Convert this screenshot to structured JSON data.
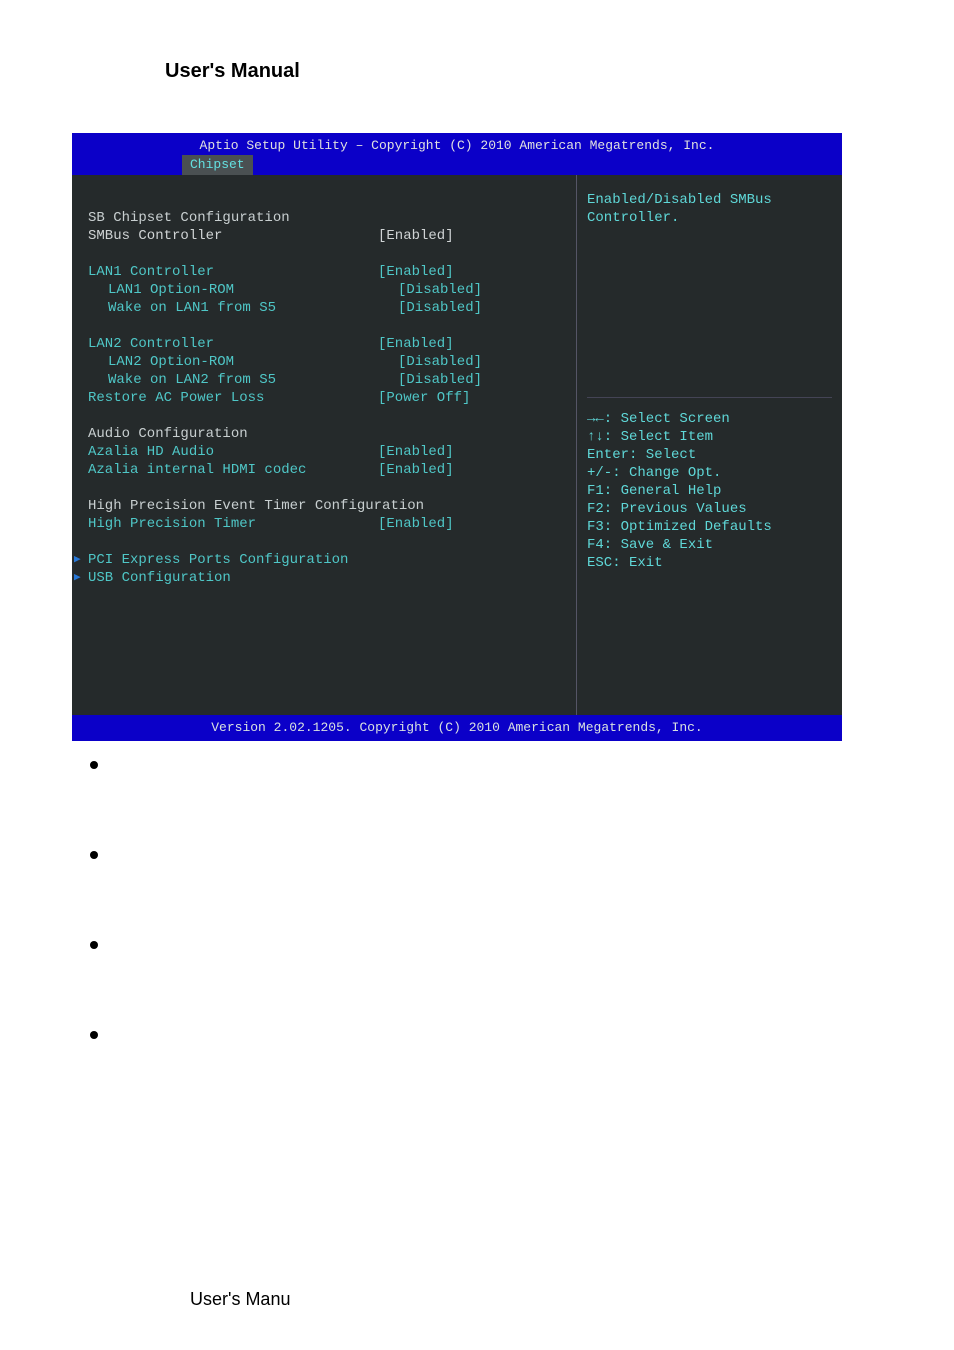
{
  "doc": {
    "header": "User's Manual",
    "footer": "User's Manu"
  },
  "bios": {
    "titlebar": "Aptio Setup Utility – Copyright (C) 2010 American Megatrends, Inc.",
    "active_tab": "Chipset",
    "footer": "Version 2.02.1205. Copyright (C) 2010 American Megatrends, Inc.",
    "left": {
      "section1": "SB Chipset Configuration",
      "smbus_lbl": "SMBus Controller",
      "smbus_val": "[Enabled]",
      "lan1_lbl": "LAN1 Controller",
      "lan1_val": "[Enabled]",
      "lan1r_lbl": "LAN1 Option-ROM",
      "lan1r_val": "[Disabled]",
      "lan1w_lbl": "Wake on LAN1 from S5",
      "lan1w_val": "[Disabled]",
      "lan2_lbl": "LAN2 Controller",
      "lan2_val": "[Enabled]",
      "lan2r_lbl": "LAN2 Option-ROM",
      "lan2r_val": "[Disabled]",
      "lan2w_lbl": "Wake on LAN2 from S5",
      "lan2w_val": "[Disabled]",
      "restore_lbl": "Restore AC Power Loss",
      "restore_val": "[Power Off]",
      "audio_hdr": "Audio Configuration",
      "azhd_lbl": "Azalia HD Audio",
      "azhd_val": "[Enabled]",
      "azhdmi_lbl": "Azalia internal HDMI codec",
      "azhdmi_val": "[Enabled]",
      "hpet_hdr": "High Precision Event Timer Configuration",
      "hpet_lbl": "High Precision Timer",
      "hpet_val": "[Enabled]",
      "sub_pci": "PCI Express Ports Configuration",
      "sub_usb": "USB Configuration"
    },
    "right": {
      "help1": "Enabled/Disabled SMBus",
      "help2": "Controller.",
      "k1": "→←: Select Screen",
      "k2": "↑↓: Select Item",
      "k3": "Enter: Select",
      "k4": "+/-: Change Opt.",
      "k5": "F1: General Help",
      "k6": "F2: Previous Values",
      "k7": "F3: Optimized Defaults",
      "k8": "F4: Save & Exit",
      "k9": "ESC: Exit"
    }
  }
}
